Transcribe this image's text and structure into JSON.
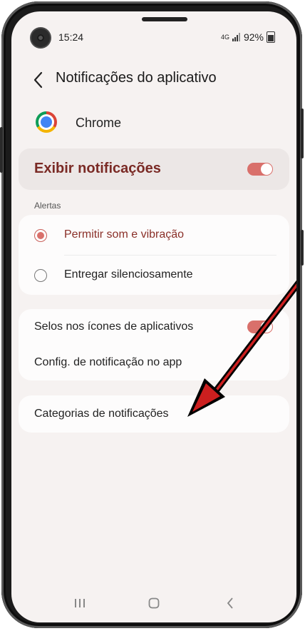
{
  "status_bar": {
    "time": "15:24",
    "network": "4G",
    "battery": "92%"
  },
  "header": {
    "title": "Notificações do aplicativo"
  },
  "app": {
    "name": "Chrome"
  },
  "show_notifications": {
    "label": "Exibir notificações",
    "enabled": true
  },
  "alerts": {
    "section_label": "Alertas",
    "options": [
      {
        "label": "Permitir som e vibração",
        "selected": true
      },
      {
        "label": "Entregar silenciosamente",
        "selected": false
      }
    ]
  },
  "settings": {
    "badges_label": "Selos nos ícones de aplicativos",
    "badges_enabled": true,
    "in_app_label": "Config. de notificação no app"
  },
  "categories": {
    "label": "Categorias de notificações"
  },
  "colors": {
    "accent": "#d9706b",
    "accent_text": "#7a2a25",
    "background": "#f6f2f1"
  },
  "icons": [
    "back-icon",
    "chrome-icon",
    "recent-apps-icon",
    "home-icon",
    "back-nav-icon"
  ]
}
